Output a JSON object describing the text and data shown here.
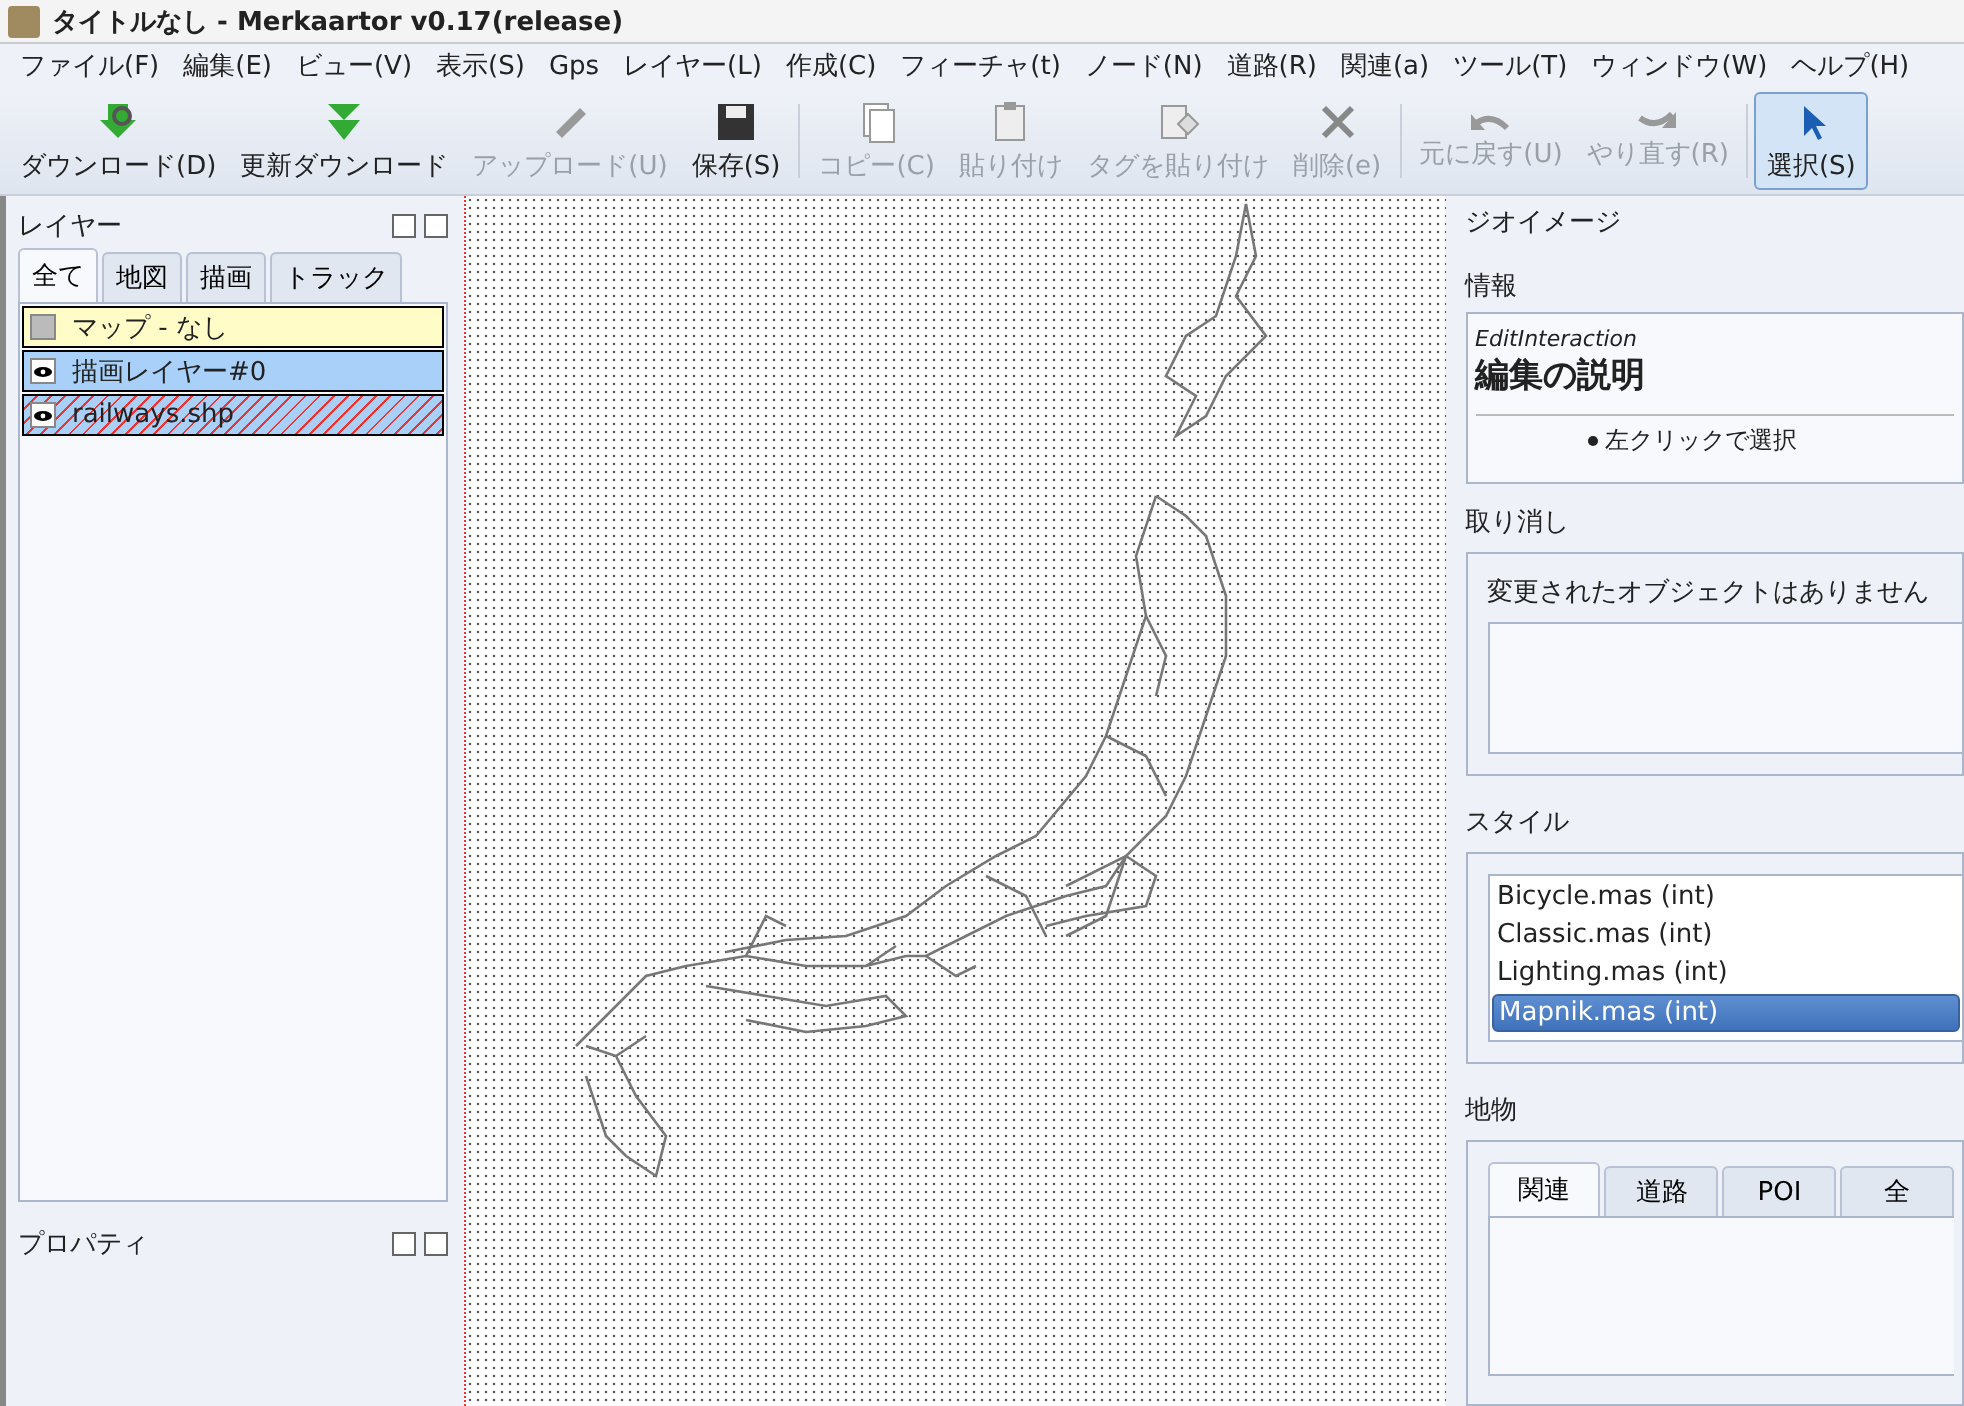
{
  "window": {
    "title": "タイトルなし - Merkaartor v0.17(release)"
  },
  "menu": [
    "ファイル(F)",
    "編集(E)",
    "ビュー(V)",
    "表示(S)",
    "Gps",
    "レイヤー(L)",
    "作成(C)",
    "フィーチャ(t)",
    "ノード(N)",
    "道路(R)",
    "関連(a)",
    "ツール(T)",
    "ウィンドウ(W)",
    "ヘルプ(H)"
  ],
  "toolbar": [
    {
      "label": "ダウンロード(D)",
      "kind": "download",
      "disabled": false,
      "selected": false
    },
    {
      "label": "更新ダウンロード",
      "kind": "update",
      "disabled": false,
      "selected": false
    },
    {
      "label": "アップロード(U)",
      "kind": "upload",
      "disabled": true,
      "selected": false
    },
    {
      "label": "保存(S)",
      "kind": "save",
      "disabled": false,
      "selected": false
    },
    {
      "label": "コピー(C)",
      "kind": "copy",
      "disabled": true,
      "selected": false
    },
    {
      "label": "貼り付け",
      "kind": "paste",
      "disabled": true,
      "selected": false
    },
    {
      "label": "タグを貼り付け",
      "kind": "pastetags",
      "disabled": true,
      "selected": false
    },
    {
      "label": "削除(e)",
      "kind": "delete",
      "disabled": true,
      "selected": false
    },
    {
      "label": "元に戻す(U)",
      "kind": "undo",
      "disabled": true,
      "selected": false
    },
    {
      "label": "やり直す(R)",
      "kind": "redo",
      "disabled": true,
      "selected": false
    },
    {
      "label": "選択(S)",
      "kind": "select",
      "disabled": false,
      "selected": true
    }
  ],
  "layers_panel": {
    "title": "レイヤー",
    "tabs": [
      {
        "label": "全て",
        "selected": true
      },
      {
        "label": "地図",
        "selected": false
      },
      {
        "label": "描画",
        "selected": false
      },
      {
        "label": "トラック",
        "selected": false
      }
    ],
    "layers": [
      {
        "name": "マップ - なし",
        "kind": "map",
        "visible": false
      },
      {
        "name": "描画レイヤー#0",
        "kind": "drawing",
        "visible": true
      },
      {
        "name": "railways.shp",
        "kind": "track",
        "visible": true
      }
    ]
  },
  "properties_panel": {
    "title": "プロパティ"
  },
  "geoimage_panel": {
    "title": "ジオイメージ"
  },
  "info_panel": {
    "title": "情報",
    "subtitle": "EditInteraction",
    "heading": "編集の説明",
    "bullet": "左クリックで選択"
  },
  "undo_panel": {
    "title": "取り消し",
    "message": "変更されたオブジェクトはありません"
  },
  "style_panel": {
    "title": "スタイル",
    "items": [
      {
        "label": "Bicycle.mas (int)",
        "selected": false
      },
      {
        "label": "Classic.mas (int)",
        "selected": false
      },
      {
        "label": "Lighting.mas (int)",
        "selected": false
      },
      {
        "label": "Mapnik.mas (int)",
        "selected": true
      }
    ]
  },
  "features_panel": {
    "title": "地物",
    "tabs": [
      {
        "label": "関連",
        "selected": true
      },
      {
        "label": "道路",
        "selected": false
      },
      {
        "label": "POI",
        "selected": false
      },
      {
        "label": "全",
        "selected": false
      }
    ]
  }
}
